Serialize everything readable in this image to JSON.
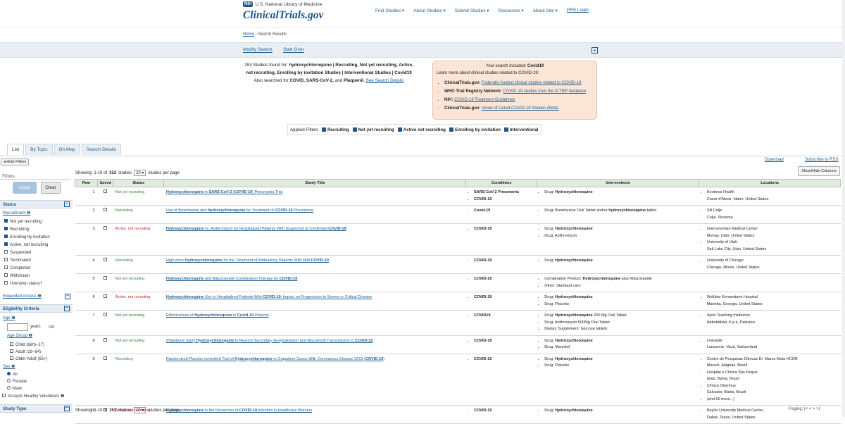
{
  "header": {
    "nih_badge": "NIH",
    "nih_text": "U.S. National Library of Medicine",
    "logo": "ClinicalTrials.gov",
    "nav": [
      "Find Studies ▾",
      "About Studies ▾",
      "Submit Studies ▾",
      "Resources ▾",
      "About Site ▾",
      "PRS Login"
    ]
  },
  "breadcrumb": {
    "home": "Home",
    "sep": "›",
    "current": "Search Results"
  },
  "actions": {
    "modify": "Modify Search",
    "start_over": "Start Over",
    "plus": "+"
  },
  "found": {
    "prefix": "153 Studies found for:",
    "query": "hydroxychloroquine | Recruiting, Not yet recruiting, Active, not recruiting, Enrolling by invitation Studies | Interventional Studies | Covid19",
    "also_prefix": "Also searched for",
    "also_terms": "COVID, SARS-CoV-2,",
    "also_and": "and",
    "also_last": "Plaquenil.",
    "see_details": "See Search Details"
  },
  "covid_box": {
    "included_prefix": "Your search included:",
    "included_term": "Covid19",
    "learn": "Learn more about clinical studies related to COVID-19:",
    "links": [
      {
        "source": "ClinicalTrials.gov:",
        "text": "Federally-funded clinical studies related to COVID-19"
      },
      {
        "source": "WHO Trial Registry Network:",
        "text": "COVID-19 studies from the ICTRP database"
      },
      {
        "source": "NIH:",
        "text": "COVID-19 Treatment Guidelines"
      },
      {
        "source": "ClinicalTrials.gov:",
        "text": "Views of Listed COVID-19 Studies (Beta)"
      }
    ]
  },
  "applied_filters": {
    "label": "Applied Filters:",
    "items": [
      "Recruiting",
      "Not yet recruiting",
      "Active not recruiting",
      "Enrolling by invitation",
      "Interventional"
    ]
  },
  "tabs": [
    "List",
    "By Topic",
    "On Map",
    "Search Details"
  ],
  "hide_filters": "◂ Hide Filters",
  "sidebar": {
    "title": "Filters",
    "apply": "Apply",
    "clear": "Clear",
    "status_header": "Status",
    "recruitment_label": "Recruitment ❶",
    "recruitment": [
      {
        "label": "Not yet recruiting",
        "checked": true
      },
      {
        "label": "Recruiting",
        "checked": true
      },
      {
        "label": "Enrolling by invitation",
        "checked": true
      },
      {
        "label": "Active, not recruiting",
        "checked": true
      },
      {
        "label": "Suspended",
        "checked": false
      },
      {
        "label": "Terminated",
        "checked": false
      },
      {
        "label": "Completed",
        "checked": false
      },
      {
        "label": "Withdrawn",
        "checked": false
      },
      {
        "label": "Unknown status†",
        "checked": false
      }
    ],
    "expanded_access": "Expanded Access ❶",
    "eligibility_header": "Eligibility Criteria",
    "age_label": "Age ❶",
    "years": "years",
    "or": "OR",
    "age_group_label": "Age Group ❶",
    "age_groups": [
      "Child (birth–17)",
      "Adult (18–64)",
      "Older Adult (65+)"
    ],
    "sex_label": "Sex ❶",
    "sex": [
      {
        "label": "All",
        "checked": true
      },
      {
        "label": "Female",
        "checked": false
      },
      {
        "label": "Male",
        "checked": false
      }
    ],
    "healthy": "Accepts Healthy Volunteers ❶",
    "study_type_header": "Study Type"
  },
  "toolbar": {
    "download": "Download",
    "rss": "Subscribe to RSS",
    "show_hide": "Show/Hide Columns",
    "showing_prefix": "Showing: 1-10 of",
    "showing_count": "153",
    "showing_studies": "studies",
    "per_page_value": "10 ▾",
    "per_page_label": "studies per page"
  },
  "table": {
    "headers": [
      "Row",
      "Saved",
      "Status",
      "Study Title",
      "Conditions",
      "Interventions",
      "Locations"
    ],
    "rows": [
      {
        "row": "1",
        "status": "Not yet recruiting",
        "status_kind": "N",
        "title": "Hydroxychloroquine in SARS-CoV-2 (COVID-19) Pneumonia Trial",
        "conditions": [
          "SARS-CoV-2 Pneumonia",
          "COVID-19"
        ],
        "interventions": [
          "Drug: Hydroxychloroquine"
        ],
        "locations": [
          "Kootenai Health\nCoeur d'Alene, Idaho, United States"
        ]
      },
      {
        "row": "2",
        "status": "Recruiting",
        "status_kind": "R",
        "title": "Use of Bromhexine and Hydroxychloroquine for Treatment of COVID-19 Pneumonia",
        "conditions": [
          "Covid-19"
        ],
        "interventions": [
          "Drug: Bromhexine Oral Tablet and/or hydroxychloroquine tablet"
        ],
        "locations": [
          "SB Celje\nCelje, Slovenia"
        ]
      },
      {
        "row": "3",
        "status": "Active, not recruiting",
        "status_kind": "A",
        "title": "Hydroxychloroquine vs. Azithromycin for Hospitalized Patients With Suspected or Confirmed COVID-19",
        "conditions": [
          "COVID-19"
        ],
        "interventions": [
          "Drug: Hydroxychloroquine",
          "Drug: Azithromycin"
        ],
        "locations": [
          "Intermountain Medical Center\nMurray, Utah, United States",
          "University of Utah\nSalt Lake City, Utah, United States"
        ]
      },
      {
        "row": "4",
        "status": "Recruiting",
        "status_kind": "R",
        "title": "High-dose Hydroxychloroquine for the Treatment of Ambulatory Patients With Mild COVID-19",
        "conditions": [
          "COVID-19"
        ],
        "interventions": [
          "Drug: Hydroxychloroquine"
        ],
        "locations": [
          "University of Chicago\nChicago, Illinois, United States"
        ]
      },
      {
        "row": "5",
        "status": "Not yet recruiting",
        "status_kind": "N",
        "title": "Hydroxychloroquine and Nitazoxanide Combination Therapy for COVID-19",
        "conditions": [
          "COVID-19"
        ],
        "interventions": [
          "Combination Product: Hydroxychloroquine plus Nitazoxanide",
          "Other: Standard care"
        ],
        "locations": []
      },
      {
        "row": "6",
        "status": "Active, not recruiting",
        "status_kind": "A",
        "title": "Hydroxychloroquine Use in Hospitalized Patients With COVID-19: Impact on Progression to Severe or Critical Disease",
        "conditions": [
          "COVID-19"
        ],
        "interventions": [
          "Drug: Hydroxychloroquine",
          "Drug: Placebo"
        ],
        "locations": [
          "Wellstar Kennestone Hospital\nMarietta, Georgia, United States"
        ]
      },
      {
        "row": "7",
        "status": "Not yet recruiting",
        "status_kind": "N",
        "title": "Effectiveness of Hydroxychloroquine in Covid-19 Patients",
        "conditions": [
          "COVID19"
        ],
        "interventions": [
          "Drug: Hydroxychloroquine 200 Mg Oral Tablet",
          "Drug: Azithromycin 500Mg Oral Tablet",
          "Dietary Supplement: Glucose tablets"
        ],
        "locations": [
          "Ayub Teaching Institution\nAbbottābād, K.p.k, Pakistan"
        ]
      },
      {
        "row": "8",
        "status": "Not yet recruiting",
        "status_kind": "N",
        "title": "#StaHome: Early Hydroxychloroquine to Reduce Secondary Hospitalisation and Household Transmission in COVID-19",
        "conditions": [
          "COVID-19"
        ],
        "interventions": [
          "Drug: Hydroxychloroquine",
          "Drug: Mannitol"
        ],
        "locations": [
          "Unisanté\nLausanne, Vaud, Switzerland"
        ]
      },
      {
        "row": "9",
        "status": "Recruiting",
        "status_kind": "R",
        "title": "Randomized Placebo-controlled Trial of Hydroxychloroquine in Outpatient Cases With Coronavirus Disease 2019 (COVID-19)",
        "conditions": [
          "COVID-19"
        ],
        "interventions": [
          "Drug: Hydroxychloroquine",
          "Drug: Placebo"
        ],
        "locations": [
          "Centro de Pesquisas Clínicas Dr. Marco Mota HCOR\nMaceió, Alagoas, Brazil",
          "Hospital e Clínica São Roque\nIpiaú, Bahia, Brazil",
          "Clínica Otorrinus\nSalvador, Bahia, Brazil",
          "(and 66 more...)"
        ]
      },
      {
        "row": "10",
        "status": "Active, not recruiting",
        "status_kind": "A",
        "title": "Hydroxychloroquine in the Prevention of COVID-19 Infection in Healthcare Workers",
        "conditions": [
          "COVID-19"
        ],
        "interventions": [
          "Drug: Hydroxychloroquine"
        ],
        "locations": [
          "Baylor University Medical Center\nDallas, Texas, United States"
        ]
      }
    ]
  },
  "paging": "Paging: |<  <  >  >|"
}
